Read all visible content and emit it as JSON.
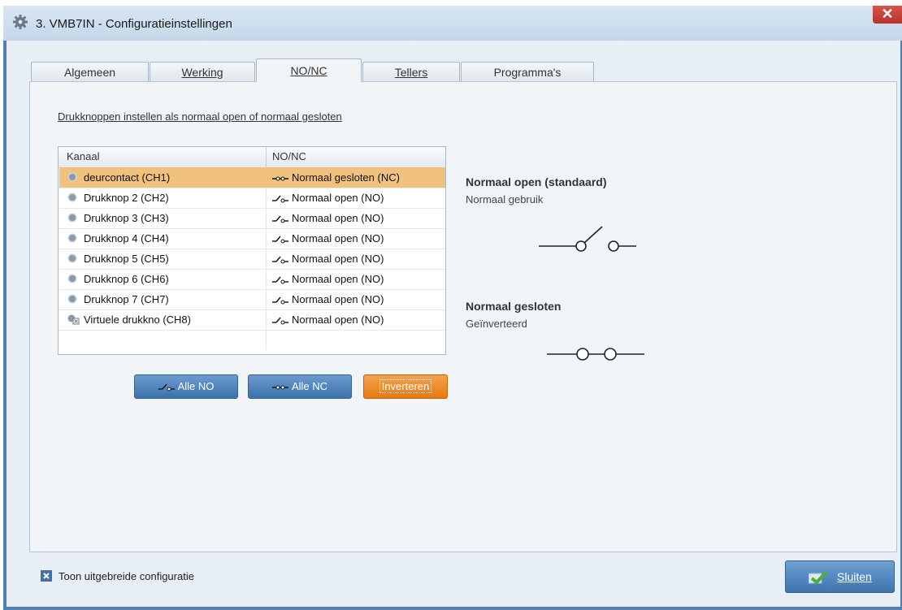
{
  "window": {
    "title": "3. VMB7IN - Configuratieinstellingen",
    "close_glyph": "✕"
  },
  "tabs": [
    {
      "label": "Algemeen",
      "active": false
    },
    {
      "label": "Werking",
      "active": false
    },
    {
      "label": "NO/NC",
      "active": true
    },
    {
      "label": "Tellers",
      "active": false
    },
    {
      "label": "Programma's",
      "active": false
    }
  ],
  "panel": {
    "heading": "Drukknoppen instellen als normaal open of normaal gesloten",
    "table": {
      "columns": [
        "Kanaal",
        "NO/NC"
      ],
      "rows": [
        {
          "channel": "deurcontact (CH1)",
          "state": "Normaal gesloten (NC)",
          "selected": true,
          "icon": "radio-bullet-icon",
          "state_icon": "switch-closed-icon"
        },
        {
          "channel": "Drukknop 2 (CH2)",
          "state": "Normaal open (NO)",
          "selected": false,
          "icon": "radio-bullet-icon",
          "state_icon": "switch-open-icon"
        },
        {
          "channel": "Drukknop 3 (CH3)",
          "state": "Normaal open (NO)",
          "selected": false,
          "icon": "radio-bullet-icon",
          "state_icon": "switch-open-icon"
        },
        {
          "channel": "Drukknop 4 (CH4)",
          "state": "Normaal open (NO)",
          "selected": false,
          "icon": "radio-bullet-icon",
          "state_icon": "switch-open-icon"
        },
        {
          "channel": "Drukknop 5 (CH5)",
          "state": "Normaal open (NO)",
          "selected": false,
          "icon": "radio-bullet-icon",
          "state_icon": "switch-open-icon"
        },
        {
          "channel": "Drukknop 6 (CH6)",
          "state": "Normaal open (NO)",
          "selected": false,
          "icon": "radio-bullet-icon",
          "state_icon": "switch-open-icon"
        },
        {
          "channel": "Drukknop 7 (CH7)",
          "state": "Normaal open (NO)",
          "selected": false,
          "icon": "radio-bullet-icon",
          "state_icon": "switch-open-icon"
        },
        {
          "channel": "Virtuele drukkno (CH8)",
          "state": "Normaal open (NO)",
          "selected": false,
          "icon": "virtual-button-icon",
          "state_icon": "switch-open-icon"
        }
      ]
    },
    "buttons": {
      "all_no": "Alle NO",
      "all_nc": "Alle NC",
      "invert": "Inverteren"
    },
    "info": {
      "no_title": "Normaal open (standaard)",
      "no_sub": "Normaal gebruik",
      "nc_title": "Normaal gesloten",
      "nc_sub": "Geïnverteerd"
    }
  },
  "footer": {
    "checkbox_label": "Toon uitgebreide configuratie",
    "checkbox_checked": true,
    "close_label": "Sluiten"
  },
  "colors": {
    "selected_row": "#f0c27e",
    "accent_orange": "#e67a12",
    "accent_blue": "#3e72ad"
  }
}
